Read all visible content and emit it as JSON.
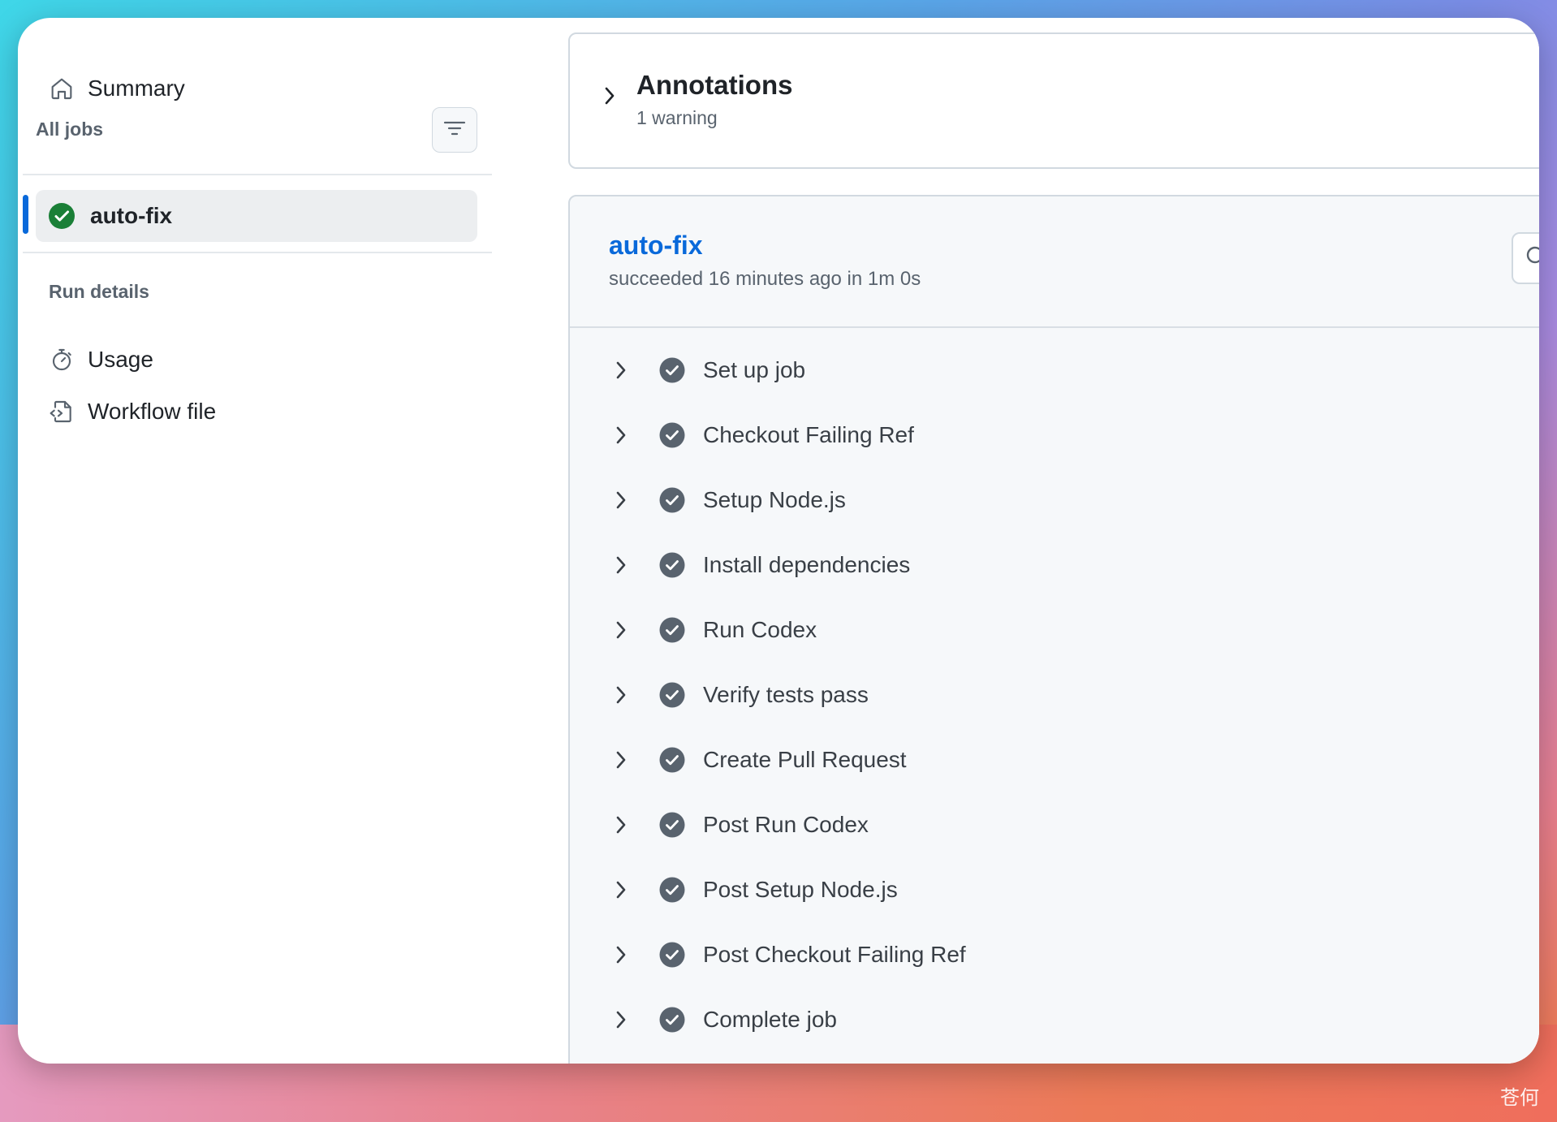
{
  "sidebar": {
    "summary_label": "Summary",
    "all_jobs_label": "All jobs",
    "jobs": [
      {
        "label": "auto-fix",
        "status": "success"
      }
    ],
    "run_details_label": "Run details",
    "usage_label": "Usage",
    "workflow_file_label": "Workflow file"
  },
  "annotations": {
    "title": "Annotations",
    "subtitle": "1 warning"
  },
  "job": {
    "title": "auto-fix",
    "status_text": "succeeded 16 minutes ago in 1m 0s",
    "steps": [
      {
        "label": "Set up job"
      },
      {
        "label": "Checkout Failing Ref"
      },
      {
        "label": "Setup Node.js"
      },
      {
        "label": "Install dependencies"
      },
      {
        "label": "Run Codex"
      },
      {
        "label": "Verify tests pass"
      },
      {
        "label": "Create Pull Request"
      },
      {
        "label": "Post Run Codex"
      },
      {
        "label": "Post Setup Node.js"
      },
      {
        "label": "Post Checkout Failing Ref"
      },
      {
        "label": "Complete job"
      }
    ]
  },
  "watermark": "苍何",
  "colors": {
    "accent": "#0969da",
    "success": "#1a7f37",
    "step_check": "#59636e",
    "panel_bg": "#f6f8fa"
  }
}
